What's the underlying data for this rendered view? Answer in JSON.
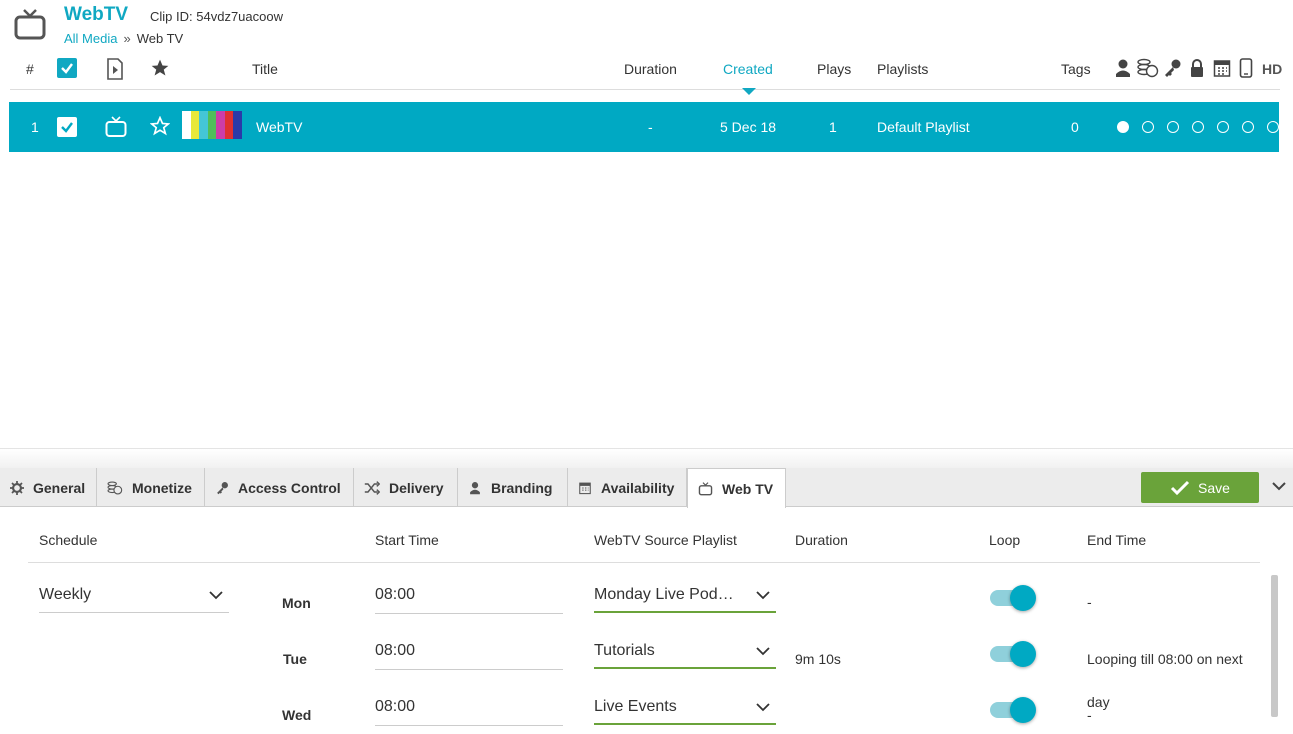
{
  "header": {
    "app_title": "WebTV",
    "clip_label": "Clip ID:",
    "clip_id": "54vdz7uacoow",
    "breadcrumb": {
      "root": "All Media",
      "separator": "»",
      "current": "Web TV"
    }
  },
  "columns": {
    "number": "#",
    "title": "Title",
    "duration": "Duration",
    "created": "Created",
    "plays": "Plays",
    "playlists": "Playlists",
    "tags": "Tags",
    "hd": "HD"
  },
  "rows": [
    {
      "number": "1",
      "title": "WebTV",
      "duration": "-",
      "created": "5 Dec 18",
      "plays": "1",
      "playlists": "Default Playlist",
      "tags": "0",
      "status_dots": [
        true,
        false,
        false,
        false,
        false,
        false,
        false
      ],
      "thumbnail_colors": [
        "#ffffff",
        "#e8e83a",
        "#44c6d6",
        "#4fbf5a",
        "#cc3da8",
        "#e03030",
        "#2b3aa8"
      ]
    }
  ],
  "tabs": [
    {
      "label": "General",
      "icon": "gear-icon"
    },
    {
      "label": "Monetize",
      "icon": "coins-icon"
    },
    {
      "label": "Access Control",
      "icon": "key-icon"
    },
    {
      "label": "Delivery",
      "icon": "shuffle-icon"
    },
    {
      "label": "Branding",
      "icon": "user-icon"
    },
    {
      "label": "Availability",
      "icon": "calendar-icon"
    },
    {
      "label": "Web TV",
      "icon": "tv-icon",
      "active": true
    }
  ],
  "save_label": "Save",
  "schedule": {
    "headers": {
      "schedule": "Schedule",
      "start_time": "Start Time",
      "source_playlist": "WebTV Source Playlist",
      "duration": "Duration",
      "loop": "Loop",
      "end_time": "End Time"
    },
    "frequency": "Weekly",
    "days": [
      {
        "day": "Mon",
        "start": "08:00",
        "playlist": "Monday Live Pod…",
        "duration": "",
        "loop": true,
        "end": "-"
      },
      {
        "day": "Tue",
        "start": "08:00",
        "playlist": "Tutorials",
        "duration": "9m 10s",
        "loop": true,
        "end": "Looping till 08:00 on next"
      },
      {
        "day": "Wed",
        "start": "08:00",
        "playlist": "Live Events",
        "duration": "",
        "loop": true,
        "end": "day"
      }
    ],
    "wed_end_extra": "-"
  },
  "colors": {
    "accent": "#00a9c3",
    "save": "#6aa33a"
  }
}
